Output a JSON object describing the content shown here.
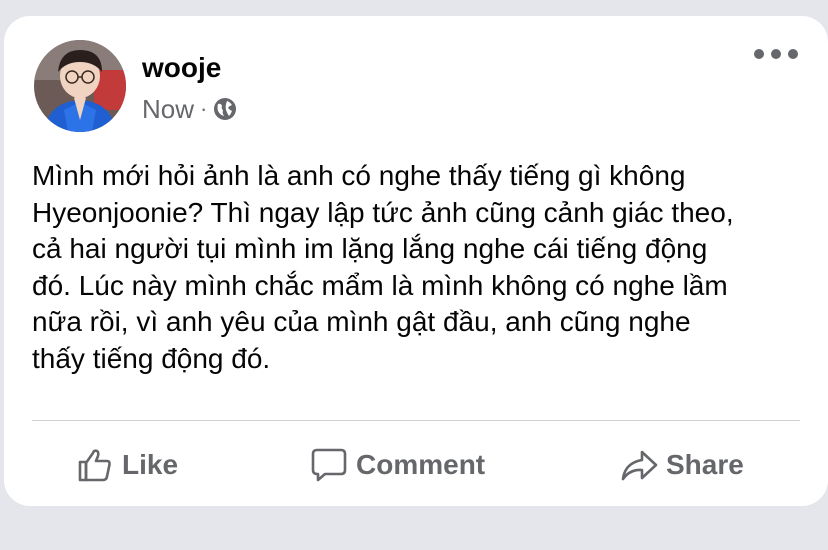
{
  "post": {
    "author": "wooje",
    "timestamp": "Now",
    "separator": "·",
    "audience_icon": "globe-icon",
    "menu_icon": "more-horizontal-icon",
    "text": "Mình mới hỏi ảnh là anh có nghe thấy tiếng gì không\nHyeonjoonie? Thì ngay lập tức ảnh cũng cảnh giác theo,\ncả hai người tụi mình im lặng lắng nghe cái tiếng động\nđó. Lúc này mình chắc mẩm là mình không có nghe lầm\nnữa rồi, vì anh yêu của mình gật đầu, anh cũng nghe\nthấy tiếng động đó."
  },
  "actions": {
    "like": {
      "label": "Like",
      "icon": "thumbs-up-icon"
    },
    "comment": {
      "label": "Comment",
      "icon": "speech-bubble-icon"
    },
    "share": {
      "label": "Share",
      "icon": "share-arrow-icon"
    }
  },
  "colors": {
    "background": "#e4e6eb",
    "card": "#ffffff",
    "text": "#050505",
    "secondary": "#65676b",
    "divider": "#ced0d4"
  }
}
